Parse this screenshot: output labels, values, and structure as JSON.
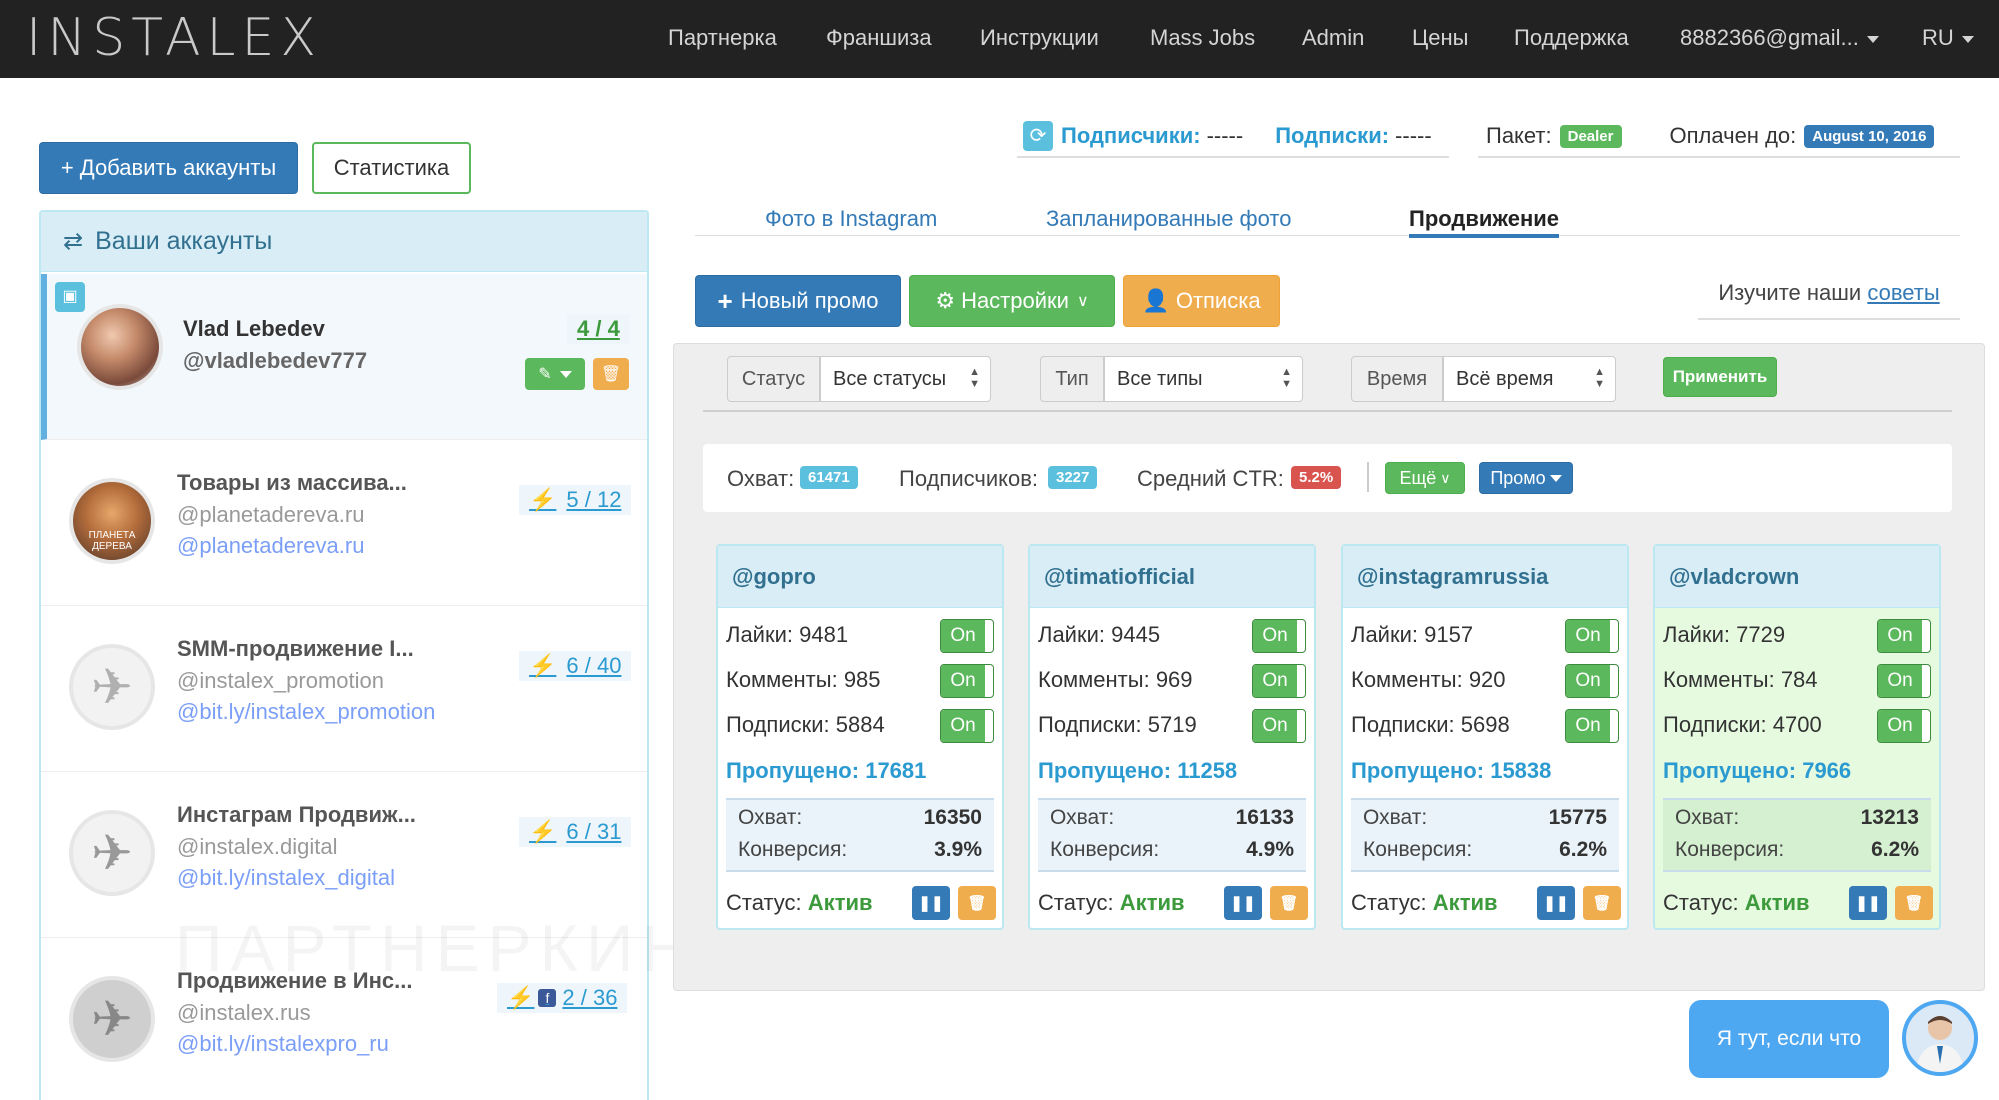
{
  "nav": {
    "brand": "INSTALEX",
    "items": [
      "Партнерка",
      "Франшиза",
      "Инструкции",
      "Mass Jobs",
      "Admin",
      "Цены",
      "Поддержка"
    ],
    "account": "8882366@gmail...",
    "lang": "RU"
  },
  "actions": {
    "add_accounts": "+ Добавить аккаунты",
    "statistics": "Статистика"
  },
  "stats": {
    "followers_label": "Подписчики:",
    "followers_value": "-----",
    "following_label": "Подписки:",
    "following_value": "-----",
    "package_label": "Пакет:",
    "package_value": "Dealer",
    "paid_label": "Оплачен до:",
    "paid_value": "August 10, 2016"
  },
  "accounts_panel": {
    "title": "Ваши аккаунты",
    "items": [
      {
        "name": "Vlad Lebedev",
        "username": "@vladlebedev777",
        "link": "",
        "count": "4 / 4"
      },
      {
        "name": "Товары из массива...",
        "username": "@planetadereva.ru",
        "link": "@planetadereva.ru",
        "count": "5 / 12",
        "avatar_text": "ПЛАНЕТА ДЕРЕВА"
      },
      {
        "name": "SMM-продвижение I...",
        "username": "@instalex_promotion",
        "link": "@bit.ly/instalex_promotion",
        "count": "6 / 40"
      },
      {
        "name": "Инстаграм Продвиж...",
        "username": "@instalex.digital",
        "link": "@bit.ly/instalex_digital",
        "count": "6 / 31"
      },
      {
        "name": "Продвижение в Инс...",
        "username": "@instalex.rus",
        "link": "@bit.ly/instalexpro_ru",
        "count": "2 / 36"
      }
    ]
  },
  "tabs": [
    "Фото в Instagram",
    "Запланированные фото",
    "Продвижение"
  ],
  "toolbar": {
    "new_promo": "Новый промо",
    "settings": "Настройки",
    "unsubscribe": "Отписка",
    "tips_prefix": "Изучите наши",
    "tips_link": "советы"
  },
  "filters": {
    "status_label": "Статус",
    "status_value": "Все статусы",
    "type_label": "Тип",
    "type_value": "Все типы",
    "time_label": "Время",
    "time_value": "Всё время",
    "apply": "Применить"
  },
  "summary": {
    "reach_label": "Охват:",
    "reach_value": "61471",
    "followers_label": "Подписчиков:",
    "followers_value": "3227",
    "ctr_label": "Средний CTR:",
    "ctr_value": "5.2%",
    "more": "Ещё",
    "promo": "Промо"
  },
  "card_labels": {
    "likes": "Лайки:",
    "comments": "Комменты:",
    "follows": "Подписки:",
    "skipped": "Пропущено:",
    "reach": "Охват:",
    "conversion": "Конверсия:",
    "status": "Статус:",
    "on": "On"
  },
  "cards": [
    {
      "handle": "@gopro",
      "likes": "9481",
      "comments": "985",
      "follows": "5884",
      "skipped": "17681",
      "reach": "16350",
      "conversion": "3.9%",
      "status": "Актив"
    },
    {
      "handle": "@timatiofficial",
      "likes": "9445",
      "comments": "969",
      "follows": "5719",
      "skipped": "11258",
      "reach": "16133",
      "conversion": "4.9%",
      "status": "Актив"
    },
    {
      "handle": "@instagramrussia",
      "likes": "9157",
      "comments": "920",
      "follows": "5698",
      "skipped": "15838",
      "reach": "15775",
      "conversion": "6.2%",
      "status": "Актив"
    },
    {
      "handle": "@vladcrown",
      "likes": "7729",
      "comments": "784",
      "follows": "4700",
      "skipped": "7966",
      "reach": "13213",
      "conversion": "6.2%",
      "status": "Актив"
    }
  ],
  "chat": {
    "text": "Я тут, если что"
  },
  "watermark": "ПАРТНЕРКИН",
  "colors": {
    "navbar": "#222222",
    "primary": "#337ab7",
    "success": "#5cb85c",
    "warning": "#f0ad4e",
    "info_badge": "#5bc0de",
    "danger_badge": "#d9534f",
    "panel_head": "#d9edf7"
  }
}
